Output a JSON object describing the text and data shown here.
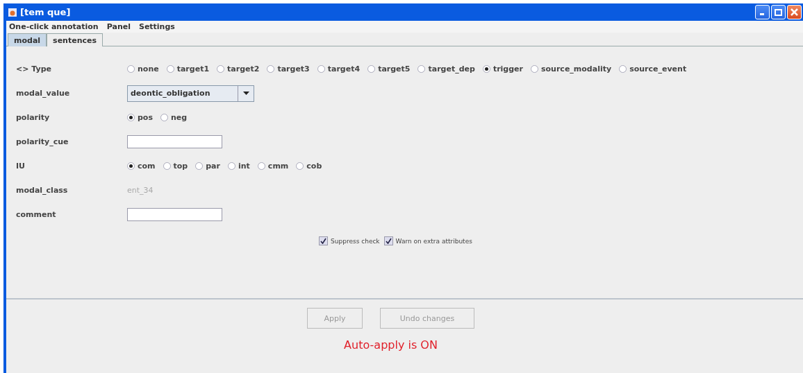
{
  "window": {
    "title": "[tem que]"
  },
  "menu": [
    "One-click annotation",
    "Panel",
    "Settings"
  ],
  "tabs": [
    {
      "label": "modal",
      "selected": true
    },
    {
      "label": "sentences",
      "selected": false
    }
  ],
  "fields": [
    {
      "label": "<> Type",
      "kind": "radio",
      "options": [
        {
          "label": "none",
          "selected": false
        },
        {
          "label": "target1",
          "selected": false
        },
        {
          "label": "target2",
          "selected": false
        },
        {
          "label": "target3",
          "selected": false
        },
        {
          "label": "target4",
          "selected": false
        },
        {
          "label": "target5",
          "selected": false
        },
        {
          "label": "target_dep",
          "selected": false
        },
        {
          "label": "trigger",
          "selected": true
        },
        {
          "label": "source_modality",
          "selected": false
        },
        {
          "label": "source_event",
          "selected": false
        }
      ]
    },
    {
      "label": "modal_value",
      "kind": "dropdown",
      "value": "deontic_obligation"
    },
    {
      "label": "polarity",
      "kind": "radio",
      "options": [
        {
          "label": "pos",
          "selected": true
        },
        {
          "label": "neg",
          "selected": false
        }
      ]
    },
    {
      "label": "polarity_cue",
      "kind": "input"
    },
    {
      "label": "IU",
      "kind": "radio",
      "options": [
        {
          "label": "com",
          "selected": true
        },
        {
          "label": "top",
          "selected": false
        },
        {
          "label": "par",
          "selected": false
        },
        {
          "label": "int",
          "selected": false
        },
        {
          "label": "cmm",
          "selected": false
        },
        {
          "label": "cob",
          "selected": false
        }
      ]
    },
    {
      "label": "modal_class",
      "kind": "text",
      "value": "ent_34"
    },
    {
      "label": "comment",
      "kind": "input"
    }
  ],
  "checkboxes": [
    {
      "label": "Suppress check",
      "checked": true
    },
    {
      "label": "Warn on extra attributes",
      "checked": true
    }
  ],
  "buttons": [
    {
      "label": "Apply",
      "disabled": true
    },
    {
      "label": "Undo changes",
      "disabled": true
    }
  ],
  "status": "Auto-apply is ON"
}
